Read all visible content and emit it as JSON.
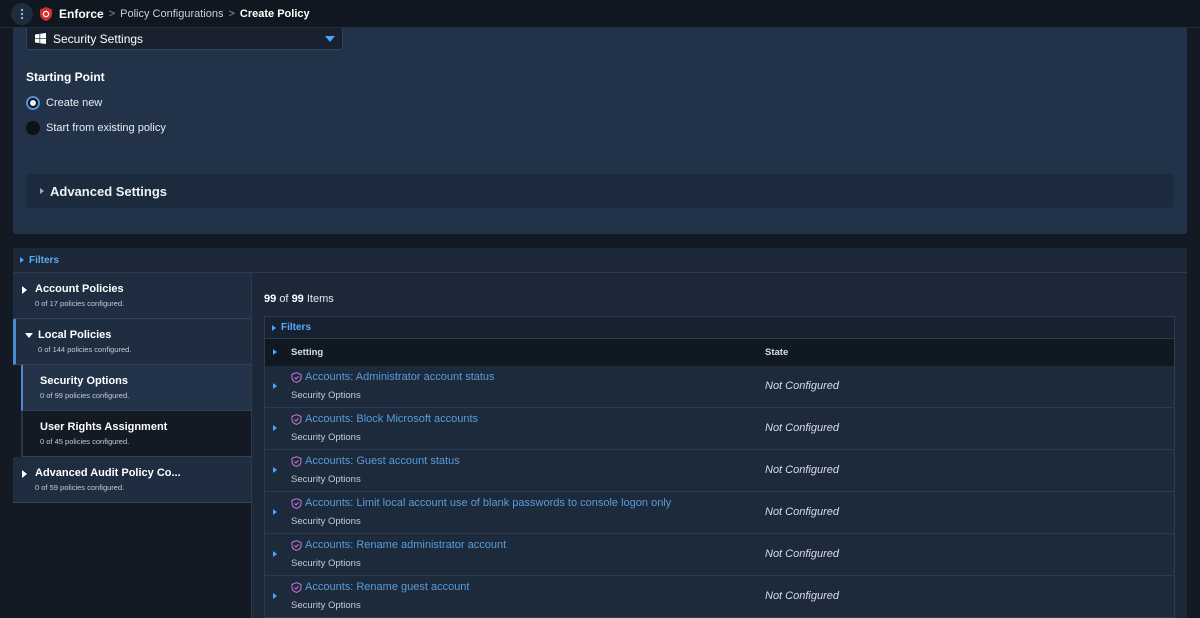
{
  "topbar": {
    "menu_icon": "kebab-menu-icon",
    "logo_icon": "shield-logo-icon",
    "app_name": "Enforce",
    "breadcrumb": {
      "link": "Policy Configurations",
      "current": "Create Policy",
      "separator": ">"
    }
  },
  "policy_form": {
    "os_select": {
      "icon": "windows-icon",
      "value": "Security Settings"
    },
    "starting_point": {
      "label": "Starting Point",
      "options": [
        {
          "label": "Create new",
          "selected": true
        },
        {
          "label": "Start from existing policy",
          "selected": false
        }
      ]
    },
    "advanced_settings_label": "Advanced Settings"
  },
  "filters_label": "Filters",
  "nav": {
    "items": [
      {
        "title": "Account Policies",
        "sub": "0 of 17 policies configured."
      },
      {
        "title": "Local Policies",
        "sub": "0 of 144 policies configured."
      },
      {
        "title": "Security Options",
        "sub": "0 of 99 policies configured."
      },
      {
        "title": "User Rights Assignment",
        "sub": "0 of 45 policies configured."
      },
      {
        "title": "Advanced Audit Policy Co...",
        "sub": "0 of 59 policies configured."
      }
    ]
  },
  "results": {
    "count_shown": "99",
    "count_of": "of",
    "count_total": "99",
    "count_suffix": "Items",
    "filters_label": "Filters",
    "columns": {
      "setting": "Setting",
      "state": "State"
    },
    "rows": [
      {
        "setting": "Accounts: Administrator account status",
        "category": "Security Options",
        "state": "Not Configured"
      },
      {
        "setting": "Accounts: Block Microsoft accounts",
        "category": "Security Options",
        "state": "Not Configured"
      },
      {
        "setting": "Accounts: Guest account status",
        "category": "Security Options",
        "state": "Not Configured"
      },
      {
        "setting": "Accounts: Limit local account use of blank passwords to console logon only",
        "category": "Security Options",
        "state": "Not Configured"
      },
      {
        "setting": "Accounts: Rename administrator account",
        "category": "Security Options",
        "state": "Not Configured"
      },
      {
        "setting": "Accounts: Rename guest account",
        "category": "Security Options",
        "state": "Not Configured"
      }
    ]
  },
  "colors": {
    "accent": "#4da3ff",
    "link": "#5b9bd9",
    "panel": "#223349",
    "shield_icon": "#c879d8",
    "logo_red": "#d32f2f"
  }
}
